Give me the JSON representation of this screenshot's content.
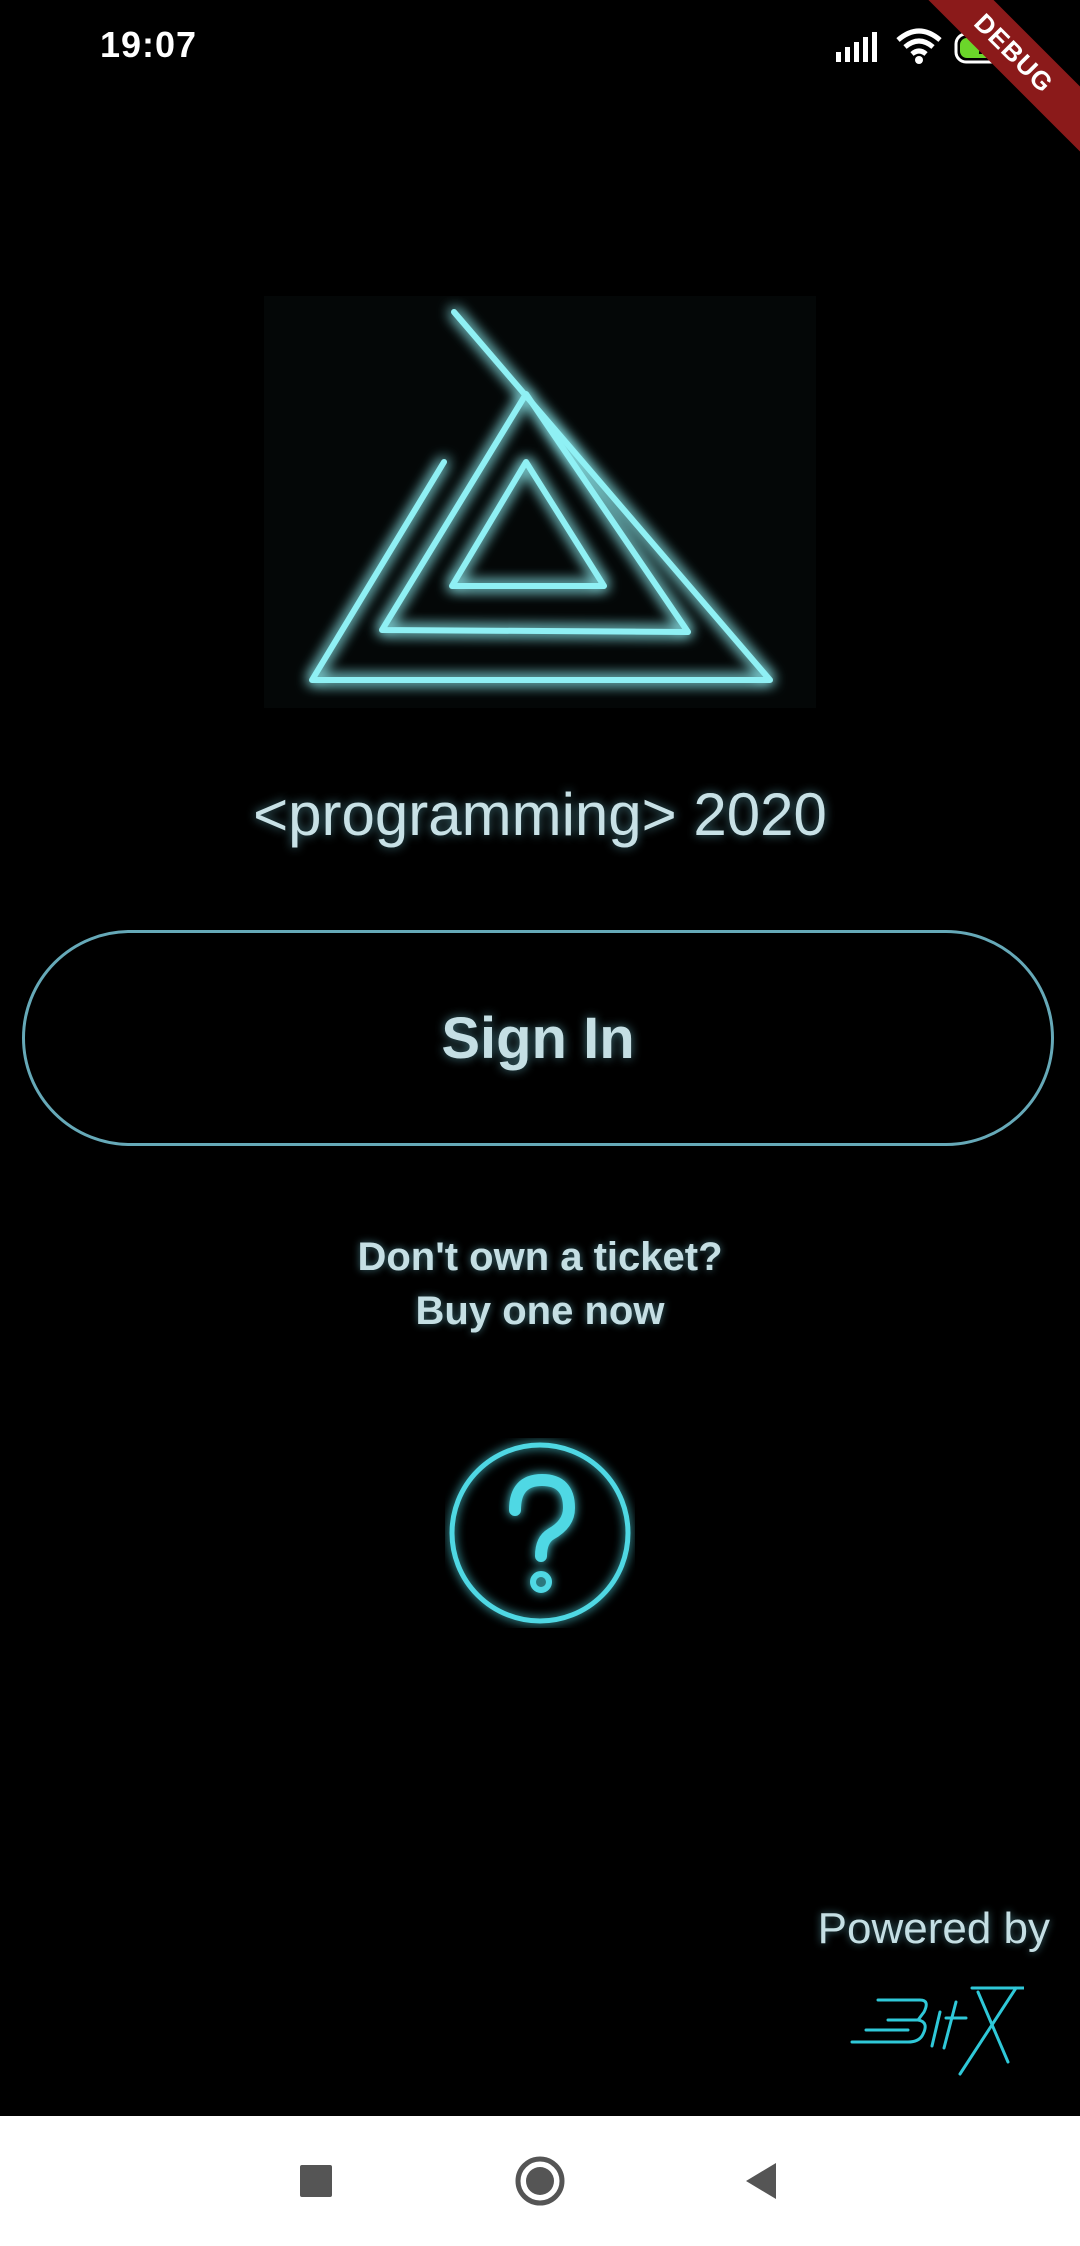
{
  "status_bar": {
    "time": "19:07",
    "battery_level": "77",
    "debug_banner": "DEBUG",
    "icons": [
      "signal-icon",
      "wifi-icon",
      "battery-icon"
    ]
  },
  "logo": {
    "icon": "neon-triangle-logo"
  },
  "event": {
    "title": "<programming> 2020"
  },
  "actions": {
    "sign_in_label": "Sign In",
    "buy_ticket_line1": "Don't own a ticket?",
    "buy_ticket_line2": "Buy one now",
    "help_icon": "question-mark-icon"
  },
  "footer": {
    "powered_by": "Powered by",
    "sponsor_logo": "bitx-logo"
  },
  "nav_bar": {
    "icons": [
      "recents-icon",
      "home-icon",
      "back-icon"
    ]
  },
  "colors": {
    "background": "#000000",
    "neon_cyan": "#4fd8e4",
    "text": "#c5dfe4",
    "button_border": "#66a9b8",
    "debug_ribbon": "#8b1a1a",
    "battery_fill": "#6bd62a"
  }
}
